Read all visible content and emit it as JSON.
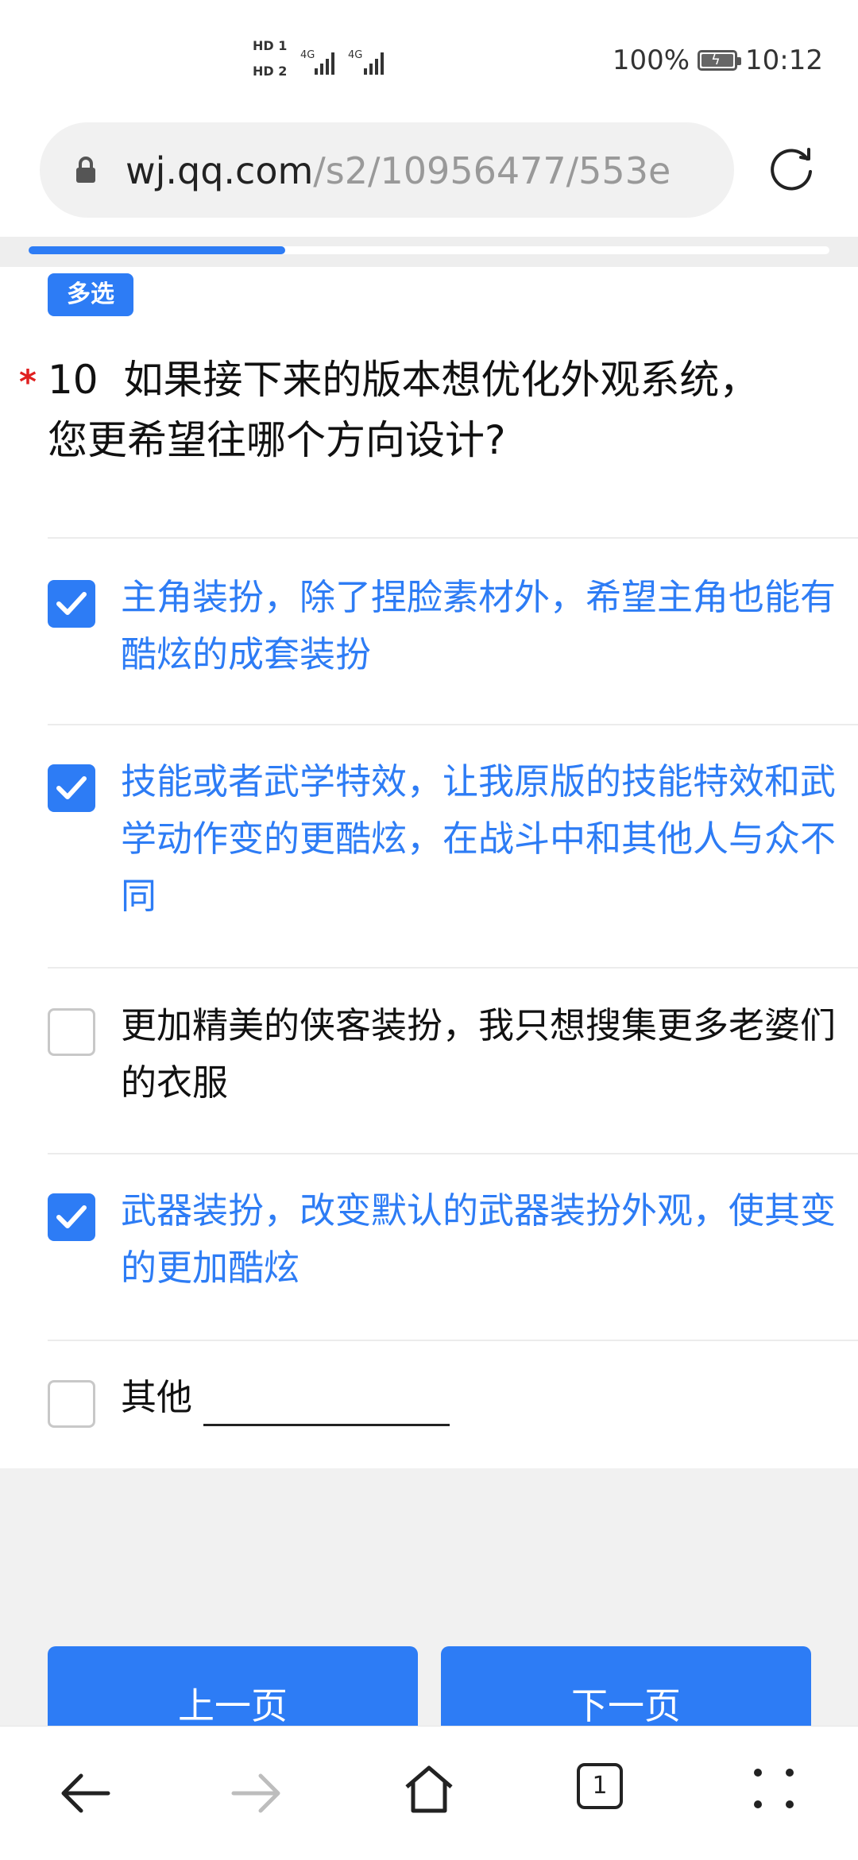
{
  "status_bar": {
    "sim1": "HD 1",
    "sim2": "HD 2",
    "net1": "4G",
    "net2": "4G",
    "battery": "100%",
    "time": "10:12"
  },
  "browser": {
    "url_host": "wj.qq.com",
    "url_path": "/s2/10956477/553e",
    "icons": [
      "lock-icon",
      "refresh-icon"
    ]
  },
  "progress": {
    "fraction": 0.32
  },
  "question": {
    "badge": "多选",
    "required_mark": "*",
    "number": "10",
    "title": "如果接下来的版本想优化外观系统，您更希望往哪个方向设计?",
    "options": [
      {
        "label": "主角装扮，除了捏脸素材外，希望主角也能有酷炫的成套装扮",
        "checked": true
      },
      {
        "label": "技能或者武学特效，让我原版的技能特效和武学动作变的更酷炫，在战斗中和其他人与众不同",
        "checked": true
      },
      {
        "label": "更加精美的侠客装扮，我只想搜集更多老婆们的衣服",
        "checked": false
      },
      {
        "label": "武器装扮，改变默认的武器装扮外观，使其变的更加酷炫",
        "checked": true
      },
      {
        "label": "其他",
        "checked": false
      }
    ]
  },
  "footer": {
    "prev_label": "上一页",
    "next_label": "下一页"
  },
  "bottom_bar": {
    "tab_count": "1",
    "icons": [
      "back-arrow-icon",
      "forward-arrow-icon",
      "home-icon",
      "tabs-icon",
      "menu-dots-icon"
    ]
  },
  "colors": {
    "accent": "#2d7cf5",
    "required": "#e02020",
    "unselected_text": "#111111"
  }
}
